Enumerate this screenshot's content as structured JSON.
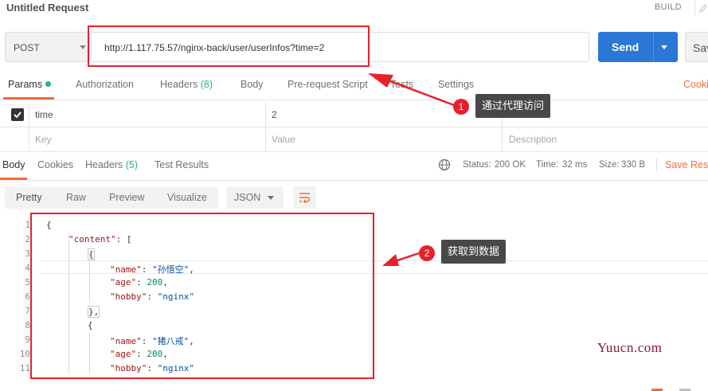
{
  "header": {
    "title": "Untitled Request",
    "build_label": "BUILD",
    "edit_icon": "pencil-icon"
  },
  "request": {
    "method": "POST",
    "url": "http://1.117.75.57/nginx-back/user/userInfos?time=2",
    "send_label": "Send",
    "save_label": "Sav"
  },
  "request_tabs": [
    {
      "label": "Params",
      "dot": true,
      "active": true
    },
    {
      "label": "Authorization"
    },
    {
      "label": "Headers",
      "count": "(8)"
    },
    {
      "label": "Body"
    },
    {
      "label": "Pre-request Script"
    },
    {
      "label": "Tests"
    },
    {
      "label": "Settings"
    }
  ],
  "cookies_link": "Cooki",
  "params": {
    "rows": [
      {
        "checked": true,
        "key": "time",
        "value": "2",
        "description": ""
      }
    ],
    "placeholder": {
      "key": "Key",
      "value": "Value",
      "description": "Description"
    }
  },
  "response_tabs": [
    {
      "label": "Body",
      "active": true
    },
    {
      "label": "Cookies"
    },
    {
      "label": "Headers",
      "count": "(5)"
    },
    {
      "label": "Test Results"
    }
  ],
  "response_status": {
    "status_label": "Status:",
    "status_value": "200 OK",
    "time_label": "Time:",
    "time_value": "32 ms",
    "size_label": "Size:",
    "size_value": "330 B",
    "save_response": "Save Resp"
  },
  "view_modes": [
    "Pretty",
    "Raw",
    "Preview",
    "Visualize"
  ],
  "format_select": "JSON",
  "code": {
    "line_numbers": [
      "1",
      "2",
      "3",
      "4",
      "5",
      "6",
      "7",
      "8",
      "9",
      "10",
      "11"
    ],
    "l1": "{",
    "l2_key": "\"content\"",
    "l2_rest": ": [",
    "l3": "{",
    "l4_key": "\"name\"",
    "l4_val": "\"孙悟空\"",
    "l5_key": "\"age\"",
    "l5_val": "200",
    "l6_key": "\"hobby\"",
    "l6_val": "\"nginx\"",
    "l7": "},",
    "l8": "{",
    "l9_key": "\"name\"",
    "l9_val": "\"猪八戒\"",
    "l10_key": "\"age\"",
    "l10_val": "200",
    "l11_key": "\"hobby\"",
    "l11_val": "\"nginx\""
  },
  "annotations": [
    {
      "number": "1",
      "text": "通过代理访问"
    },
    {
      "number": "2",
      "text": "获取到数据"
    }
  ],
  "colors": {
    "accent": "#f26b3a",
    "send": "#2a77d6",
    "success": "#26b47f",
    "annotation": "#e8202b"
  },
  "watermark": "Yuucn.com"
}
